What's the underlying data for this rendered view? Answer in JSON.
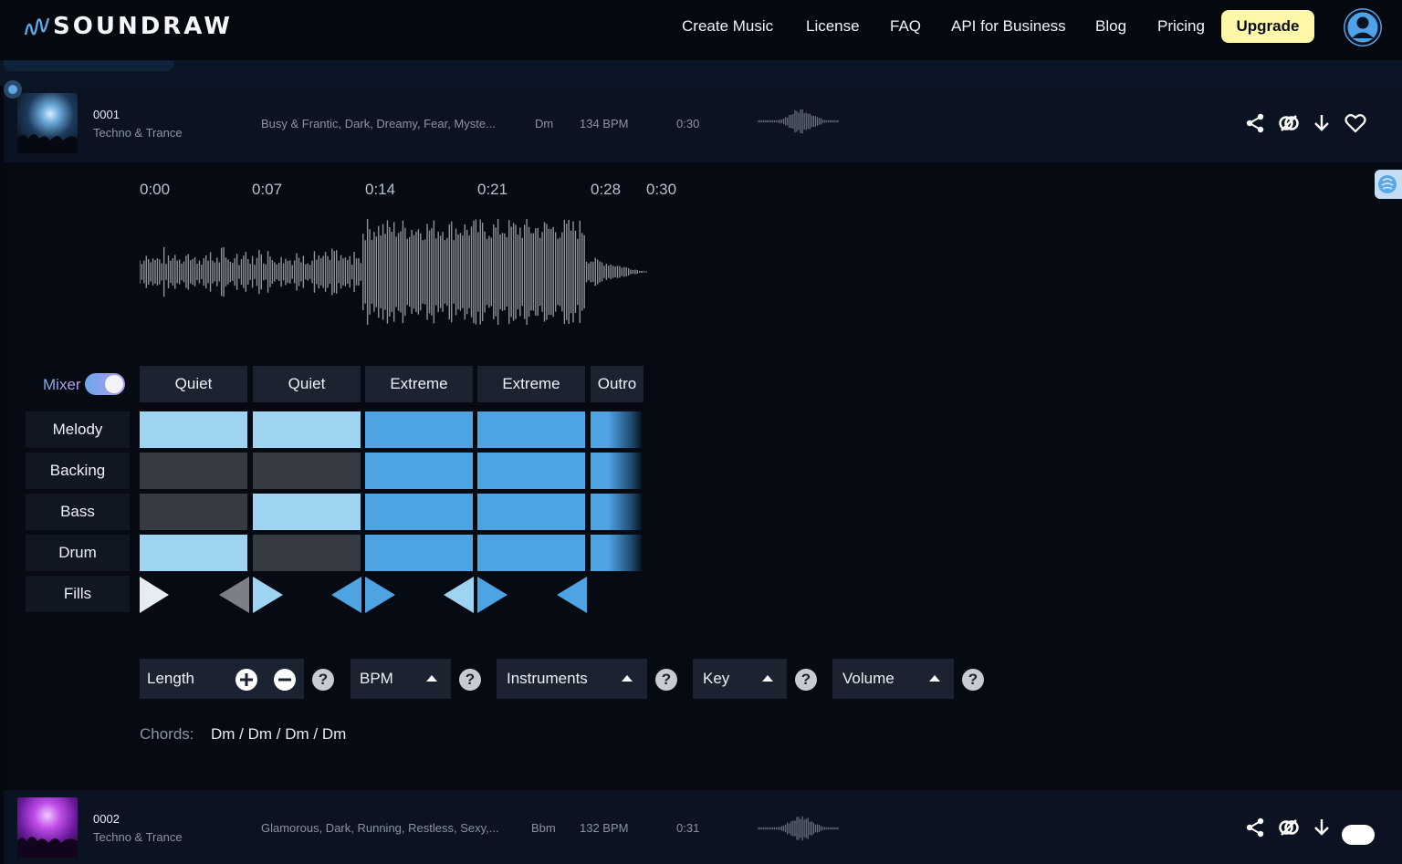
{
  "header": {
    "logo": "SOUNDRAW",
    "nav": [
      "Create Music",
      "License",
      "FAQ",
      "API for Business",
      "Blog",
      "Pricing"
    ],
    "upgrade_label": "Upgrade"
  },
  "tracks": [
    {
      "number": "0001",
      "genre": "Techno & Trance",
      "moods": "Busy & Frantic, Dark, Dreamy, Fear, Myste...",
      "key": "Dm",
      "bpm": "134 BPM",
      "duration": "0:30"
    },
    {
      "number": "0002",
      "genre": "Techno & Trance",
      "moods": "Glamorous, Dark, Running, Restless, Sexy,...",
      "key": "Bbm",
      "bpm": "132 BPM",
      "duration": "0:31"
    }
  ],
  "editor": {
    "timeline": [
      "0:00",
      "0:07",
      "0:14",
      "0:21",
      "0:28",
      "0:30"
    ],
    "mixer_label": "Mixer",
    "mixer_on": true,
    "sections": [
      "Quiet",
      "Quiet",
      "Extreme",
      "Extreme",
      "Outro"
    ],
    "rows": [
      "Melody",
      "Backing",
      "Bass",
      "Drum",
      "Fills"
    ],
    "grid": [
      [
        "light",
        "light",
        "mid",
        "mid",
        "fade"
      ],
      [
        "off",
        "off",
        "mid",
        "mid",
        "fade"
      ],
      [
        "off",
        "light",
        "mid",
        "mid",
        "fade"
      ],
      [
        "light",
        "off",
        "mid",
        "mid",
        "fade"
      ]
    ],
    "controls": {
      "length": "Length",
      "bpm": "BPM",
      "instruments": "Instruments",
      "key": "Key",
      "volume": "Volume"
    },
    "help_glyph": "?",
    "chords_label": "Chords:",
    "chords_value": "Dm / Dm / Dm / Dm"
  },
  "colors": {
    "background": "#05080f",
    "accent_light": "#9ed3f1",
    "accent": "#4ea3e2",
    "cell_off": "#353a43",
    "upgrade": "#fff8a8"
  }
}
